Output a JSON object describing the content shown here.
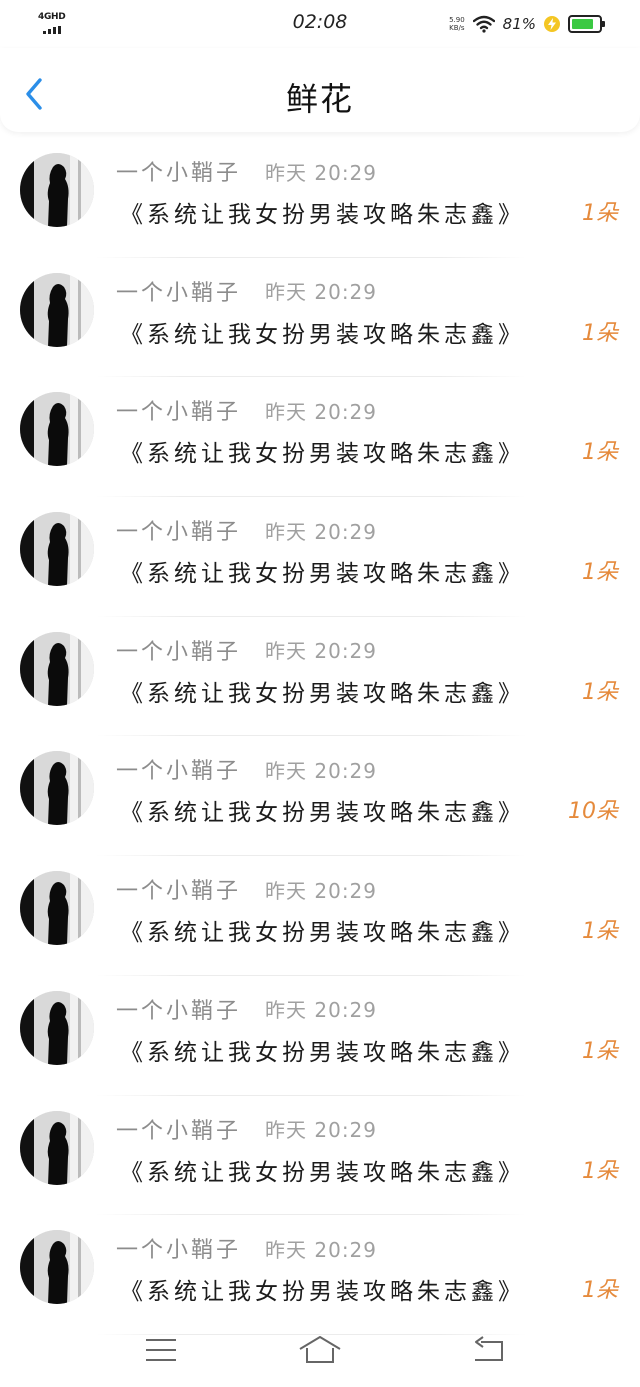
{
  "status_bar": {
    "network": "4GHD",
    "time": "02:08",
    "speed_value": "5.90",
    "speed_unit": "KB/s",
    "battery_percent": "81%",
    "battery_level": 0.81,
    "wifi_icon": "wifi-icon",
    "charging_icon": "charging-icon",
    "battery_color": "#3bc943"
  },
  "header": {
    "title": "鲜花",
    "back_icon": "chevron-left-icon",
    "accent_color": "#2b8ee8"
  },
  "list": {
    "items": [
      {
        "user": "一个小鞘子",
        "time": "昨天 20:29",
        "title": "《系统让我女扮男装攻略朱志鑫》",
        "count": "1朵"
      },
      {
        "user": "一个小鞘子",
        "time": "昨天 20:29",
        "title": "《系统让我女扮男装攻略朱志鑫》",
        "count": "1朵"
      },
      {
        "user": "一个小鞘子",
        "time": "昨天 20:29",
        "title": "《系统让我女扮男装攻略朱志鑫》",
        "count": "1朵"
      },
      {
        "user": "一个小鞘子",
        "time": "昨天 20:29",
        "title": "《系统让我女扮男装攻略朱志鑫》",
        "count": "1朵"
      },
      {
        "user": "一个小鞘子",
        "time": "昨天 20:29",
        "title": "《系统让我女扮男装攻略朱志鑫》",
        "count": "1朵"
      },
      {
        "user": "一个小鞘子",
        "time": "昨天 20:29",
        "title": "《系统让我女扮男装攻略朱志鑫》",
        "count": "10朵"
      },
      {
        "user": "一个小鞘子",
        "time": "昨天 20:29",
        "title": "《系统让我女扮男装攻略朱志鑫》",
        "count": "1朵"
      },
      {
        "user": "一个小鞘子",
        "time": "昨天 20:29",
        "title": "《系统让我女扮男装攻略朱志鑫》",
        "count": "1朵"
      },
      {
        "user": "一个小鞘子",
        "time": "昨天 20:29",
        "title": "《系统让我女扮男装攻略朱志鑫》",
        "count": "1朵"
      },
      {
        "user": "一个小鞘子",
        "time": "昨天 20:29",
        "title": "《系统让我女扮男装攻略朱志鑫》",
        "count": "1朵"
      }
    ],
    "count_color": "#e58a3c"
  },
  "nav_bar": {
    "menu_icon": "menu-icon",
    "home_icon": "home-icon",
    "back_icon": "back-arrow-icon"
  }
}
